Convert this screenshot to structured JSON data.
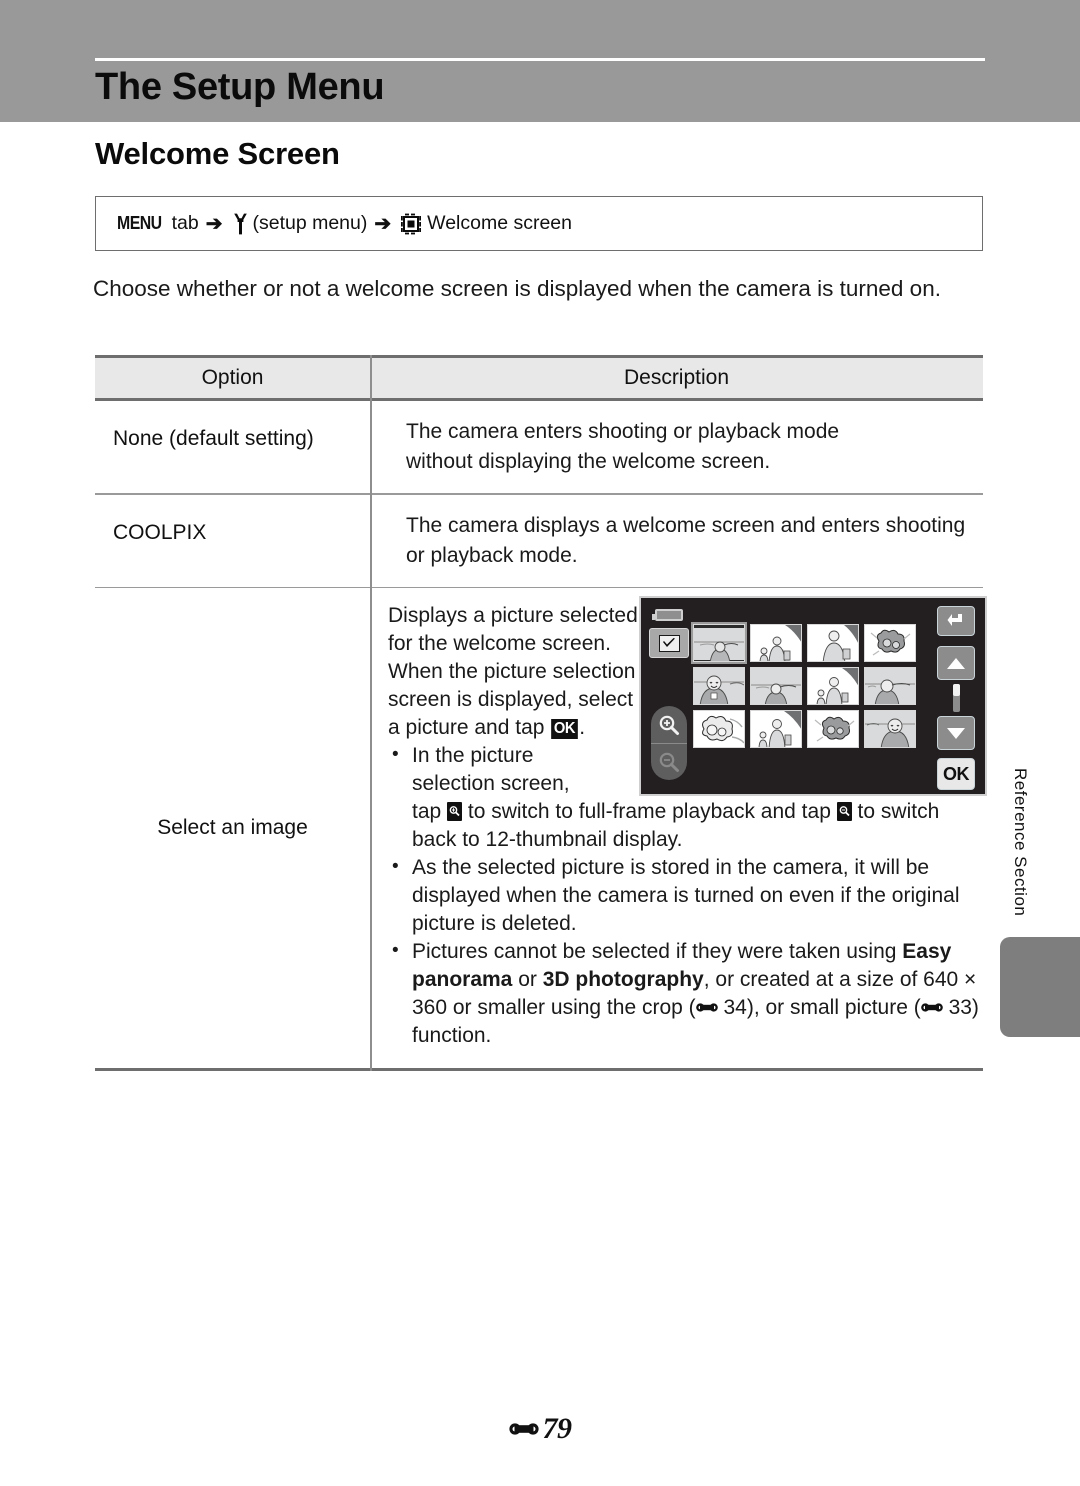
{
  "header": {
    "chapter_title": "The Setup Menu"
  },
  "section": {
    "title": "Welcome Screen"
  },
  "menu_path": {
    "menu_label": "MENU",
    "tab_word": "tab",
    "arrow": "➔",
    "setup_menu_label": "(setup menu)",
    "destination_label": "Welcome screen",
    "wrench_icon": "wrench-icon",
    "welcome_screen_icon": "welcome-screen-icon"
  },
  "intro": {
    "text": "Choose whether or not a welcome screen is displayed when the camera is turned on."
  },
  "table": {
    "headers": {
      "option": "Option",
      "description": "Description"
    },
    "rows": [
      {
        "option": "None (default setting)",
        "description": "The camera enters shooting or playback mode without displaying the welcome screen."
      },
      {
        "option": "COOLPIX",
        "description": "The camera displays a welcome screen and enters shooting or playback mode."
      }
    ],
    "select_row": {
      "option": "Select an image",
      "intro_part1": "Displays a picture selected for the welcome screen. When the picture selection screen is displayed, select a picture and tap ",
      "intro_ok": "OK",
      "intro_part2": ".",
      "bullets": [
        {
          "lead": "In the picture selection screen,",
          "line_a": "tap ",
          "mag_in_icon": "zoom-in-icon",
          "line_b": " to switch to full-frame playback and tap ",
          "mag_out_icon": "zoom-out-icon",
          "line_c": " to switch back to 12-thumbnail display."
        },
        {
          "text": "As the selected picture is stored in the camera, it will be displayed when the camera is turned on even if the original picture is deleted."
        },
        {
          "pre": "Pictures cannot be selected if they were taken using ",
          "bold1": "Easy panorama",
          "mid1": " or ",
          "bold2": "3D photography",
          "mid2": ", or created at a size of 640 × 360 or smaller using the crop (",
          "ref1": "34",
          "mid3": "), or small picture (",
          "ref2": "33",
          "post": ") function."
        }
      ]
    }
  },
  "lcd": {
    "battery_icon": "battery-icon",
    "checkbox_button_icon": "checkbox-select-icon",
    "zoom_in_icon": "zoom-in-icon",
    "zoom_out_icon": "zoom-out-icon",
    "back_button_icon": "back-arrow-icon",
    "up_button_icon": "scroll-up-icon",
    "down_button_icon": "scroll-down-icon",
    "ok_button_label": "OK",
    "thumbnail_count": 12,
    "selected_thumbnail_index": 0,
    "thumbnail_kinds": [
      "portrait-sea",
      "two-people",
      "woman-bag",
      "flowers",
      "portrait-smile",
      "portrait-sea",
      "two-people",
      "portrait-sea",
      "flowers",
      "two-people",
      "flowers",
      "portrait-smile"
    ]
  },
  "sidebar": {
    "vertical_label": "Reference Section"
  },
  "footer": {
    "page_marker_icon": "reference-dumbbell-icon",
    "page_number": "79"
  }
}
